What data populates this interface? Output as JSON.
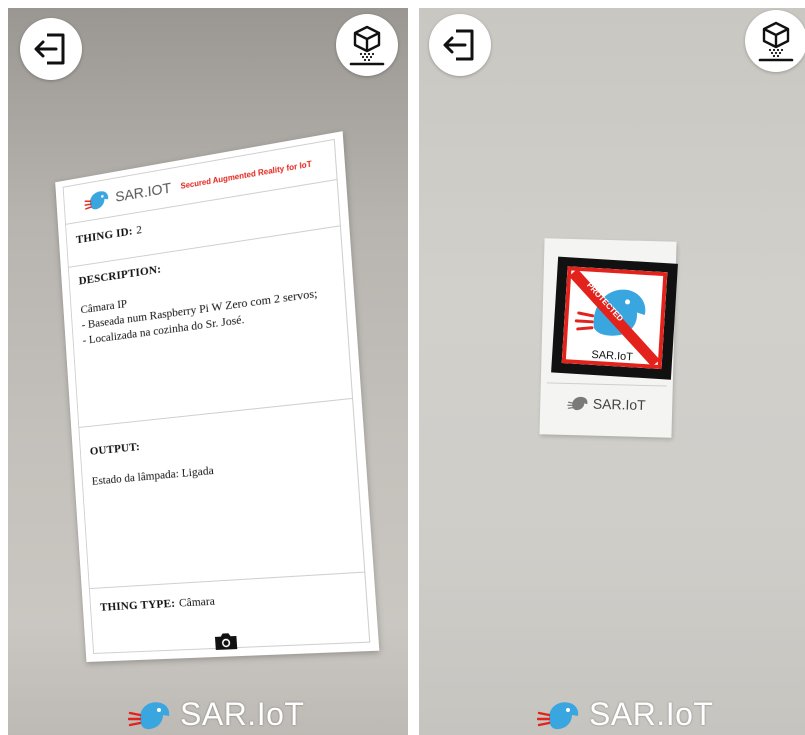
{
  "left_screen": {
    "card": {
      "brand": "SAR.IOT",
      "tagline": "Secured Augmented Reality for IoT",
      "thing_id_label": "THING ID:",
      "thing_id_value": "2",
      "description_label": "DESCRIPTION:",
      "description_text": "Câmara IP\n- Baseada num Raspberry Pi W Zero com 2 servos;\n- Localizada na cozinha do Sr. José.",
      "output_label": "OUTPUT:",
      "output_text": "Estado da lâmpada: Ligada",
      "thing_type_label": "THING TYPE:",
      "thing_type_value": "Câmara"
    },
    "bottom_logo_text": "SAR.IoT"
  },
  "right_screen": {
    "marker": {
      "protected_text": "PROTECTED",
      "inner_brand": "SAR.IoT",
      "label_text": "SAR.IoT"
    },
    "bottom_logo_text": "SAR.IoT"
  },
  "icons": {
    "exit": "exit-icon",
    "ar_mode": "ar-cube-icon",
    "camera": "camera-icon",
    "logo": "sariot-logo-icon"
  },
  "colors": {
    "accent_red": "#e3231b",
    "logo_blue": "#3aa6e0"
  }
}
